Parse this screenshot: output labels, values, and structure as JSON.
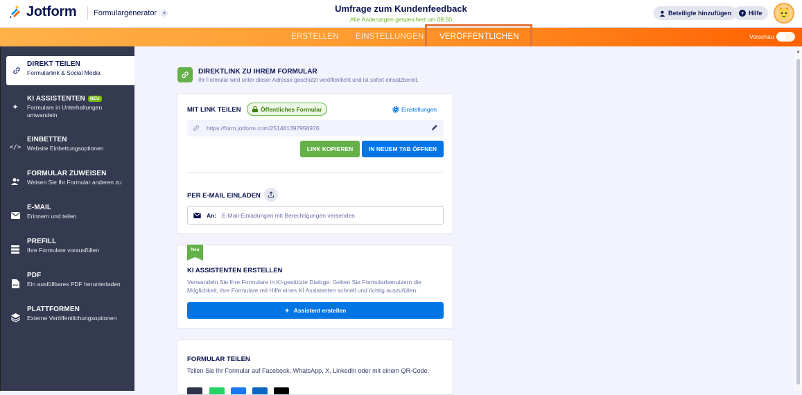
{
  "header": {
    "logo_text": "Jotform",
    "builder_menu": "Formulargenerator",
    "form_title": "Umfrage zum Kundenfeedback",
    "save_status": "Alle Änderungen gespeichert um 08:50",
    "collaborators_label": "Beteiligte hinzufügen",
    "help_label": "Hilfe"
  },
  "nav": {
    "tabs": [
      {
        "label": "ERSTELLEN"
      },
      {
        "label": "EINSTELLUNGEN"
      },
      {
        "label": "VERÖFFENTLICHEN"
      }
    ],
    "preview_label": "Vorschau"
  },
  "sidebar": {
    "items": [
      {
        "title": "DIREKT TEILEN",
        "sub": "Formularlink & Social Media",
        "icon": "link-icon"
      },
      {
        "title": "KI ASSISTENTEN",
        "badge": "NEU",
        "sub": "Formulare in Unterhaltungen umwandeln",
        "icon": "sparkle-icon"
      },
      {
        "title": "EINBETTEN",
        "sub": "Website Einbettungsoptionen",
        "icon": "code-icon"
      },
      {
        "title": "FORMULAR ZUWEISEN",
        "sub": "Weisen Sie Ihr Formular anderen zu",
        "icon": "assign-user-icon"
      },
      {
        "title": "E-MAIL",
        "sub": "Erinnern und teilen",
        "icon": "envelope-icon"
      },
      {
        "title": "PREFILL",
        "sub": "Ihre Formulare vorausfüllen",
        "icon": "prefill-icon"
      },
      {
        "title": "PDF",
        "sub": "Ein ausfüllbares PDF herunterladen",
        "icon": "pdf-icon"
      },
      {
        "title": "PLATTFORMEN",
        "sub": "Externe Veröffentlichungsoptionen",
        "icon": "layers-icon"
      }
    ]
  },
  "direct_link": {
    "title": "DIREKTLINK ZU IHREM FORMULAR",
    "subtitle": "Ihr Formular wird unter dieser Adresse geschützt veröffentlicht und ist sofort einsatzbereit."
  },
  "share_card": {
    "heading": "MIT LINK TEILEN",
    "public_badge": "Öffentliches Formular",
    "settings_link": "Einstellungen",
    "url": "https://form.jotform.com/251481397956976",
    "copy_label": "LINK KOPIEREN",
    "new_tab_label": "IN NEUEM TAB ÖFFNEN",
    "email_heading": "PER E-MAIL EINLADEN",
    "email_to": "An:",
    "email_placeholder": "E-Mail-Einladungen mit Berechtigungen versenden"
  },
  "ai_card": {
    "flag": "Neu",
    "heading": "KI ASSISTENTEN ERSTELLEN",
    "description": "Verwandeln Sie Ihre Formulare in KI-gestützte Dialoge. Geben Sie Formularbenutzern die Möglichkeit, ihre Formulare mit Hilfe eines KI Assistenten schnell und richtig auszufüllen.",
    "button_label": "Assistent erstellen"
  },
  "social_card": {
    "heading": "FORMULAR TEILEN",
    "description": "Teilen Sie Ihr Formular auf Facebook, WhatsApp, X, LinkedIn oder mit einem QR-Code."
  },
  "colors": {
    "orange_accent": "#ff6100",
    "green": "#64b149",
    "blue": "#0075e3",
    "sidebar_bg": "#343a4f",
    "highlight_box": "#e1743b"
  }
}
